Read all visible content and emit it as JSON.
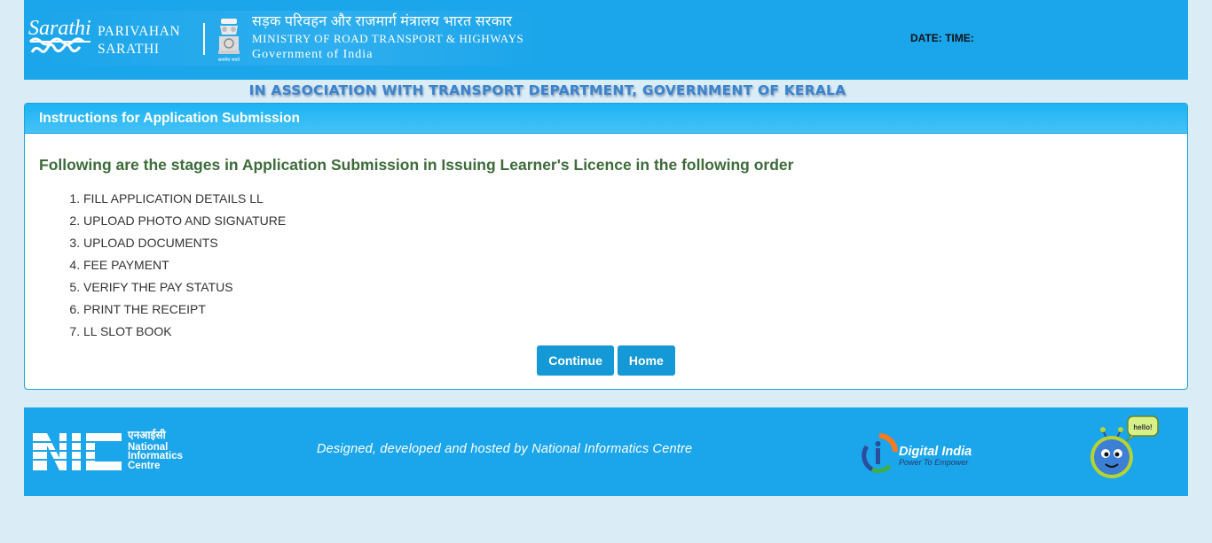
{
  "header": {
    "logo_script": "Sarathi",
    "brand_line1": "PARIVAHAN",
    "brand_line2": "SARATHI",
    "ministry_hindi": "सड़क परिवहन और राजमार्ग मंत्रालय भारत सरकार",
    "ministry_english": "MINISTRY OF ROAD TRANSPORT & HIGHWAYS",
    "government": "Government of India",
    "emblem_caption": "सत्यमेव जयते",
    "date_time_label": "DATE: TIME:"
  },
  "association": "IN ASSOCIATION WITH TRANSPORT DEPARTMENT, GOVERNMENT OF KERALA",
  "panel": {
    "title": "Instructions for Application Submission",
    "stages_heading": "Following are the stages in Application Submission in Issuing Learner's Licence in the following order",
    "stages": [
      "FILL APPLICATION DETAILS LL",
      "UPLOAD PHOTO AND SIGNATURE",
      "UPLOAD DOCUMENTS",
      "FEE PAYMENT",
      "VERIFY THE PAY STATUS",
      "PRINT THE RECEIPT",
      "LL SLOT BOOK"
    ],
    "continue_label": "Continue",
    "home_label": "Home"
  },
  "footer": {
    "nic_hindi": "एनआईसी",
    "nic_line1": "National",
    "nic_line2": "Informatics",
    "nic_line3": "Centre",
    "credit": "Designed, developed and hosted by National Informatics Centre",
    "digital_india": "Digital India",
    "digital_india_tagline": "Power To Empower",
    "mascot_bubble": "hello!"
  },
  "colors": {
    "page_background": "#daedf7",
    "header_blue": "#1ba5ea",
    "button_blue": "#1598d6",
    "stages_heading_green": "#3d6b3a",
    "association_blue": "#3a84cf"
  },
  "icons": {
    "sarathi_logo": "sarathi-logo-icon",
    "emblem": "national-emblem-icon",
    "nic_logo": "nic-logo-icon",
    "digital_india_logo": "digital-india-icon",
    "mascot": "mascot-icon"
  }
}
